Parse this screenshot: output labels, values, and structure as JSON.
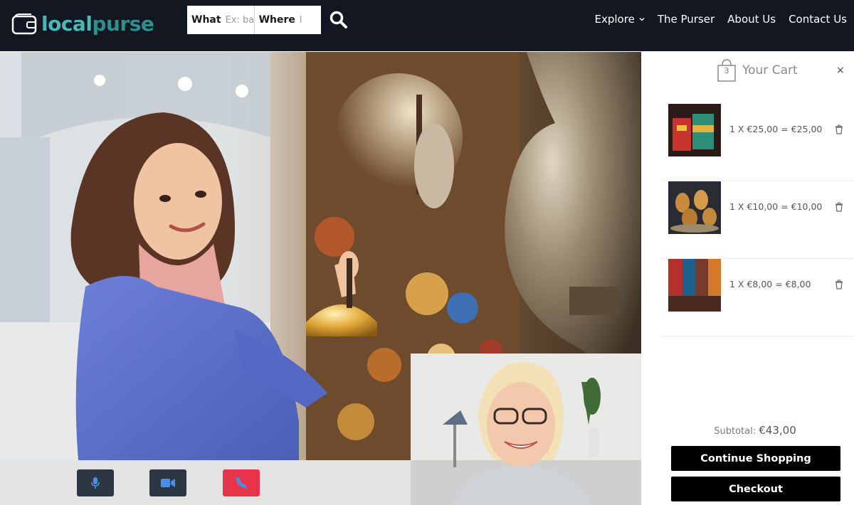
{
  "brand": {
    "part1": "local",
    "part2": "purse"
  },
  "search": {
    "what_label": "What",
    "what_placeholder": "Ex: ba",
    "where_label": "Where",
    "where_placeholder": "l"
  },
  "nav": {
    "items": [
      {
        "label": "Explore",
        "has_dropdown": true
      },
      {
        "label": "The Purser"
      },
      {
        "label": "About Us"
      },
      {
        "label": "Contact Us"
      }
    ]
  },
  "call": {
    "controls": [
      "microphone-icon",
      "video-camera-icon",
      "end-call-icon"
    ],
    "end_call_color": "#e8344b"
  },
  "cart": {
    "title": "Your Cart",
    "count": "3",
    "close": "×",
    "items": [
      {
        "line": "1 X €25,00 = €25,00",
        "thumb": "colorful-bags"
      },
      {
        "line": "1 X €10,00 = €10,00",
        "thumb": "tea-glasses"
      },
      {
        "line": "1 X €8,00 = €8,00",
        "thumb": "textiles"
      }
    ],
    "subtotal_label": "Subtotal:",
    "subtotal_value": "€43,00",
    "continue_label": "Continue Shopping",
    "checkout_label": "Checkout"
  },
  "colors": {
    "topbar": "#131722",
    "brand_teal": "#4db7b5",
    "button": "#000000"
  }
}
